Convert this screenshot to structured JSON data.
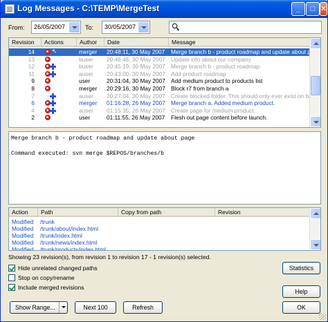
{
  "window": {
    "title": "Log Messages - C:\\TEMP\\MergeTest"
  },
  "title_buttons": {
    "minimize": "_",
    "maximize": "□",
    "close": "✕"
  },
  "filter": {
    "from_label": "From:",
    "from_value": "26/05/2007",
    "to_label": "To:",
    "to_value": "30/05/2007",
    "search_value": ""
  },
  "revision_list": {
    "columns": [
      "Revision",
      "Actions",
      "Author",
      "Date",
      "Message"
    ],
    "rows": [
      {
        "revision": "14",
        "actions": [
          "r",
          "arrow"
        ],
        "author": "merger",
        "date": "20:48:11, 30 May 2007",
        "message": "Merge branch b - product roadmap and update about page",
        "style": "sel"
      },
      {
        "revision": "13",
        "actions": [
          "r"
        ],
        "author": "buser",
        "date": "20:46:48, 30 May 2007",
        "message": "Update info about our company",
        "style": "gray"
      },
      {
        "revision": "12",
        "actions": [
          "r",
          "p"
        ],
        "author": "buser",
        "date": "20:45:19, 30 May 2007",
        "message": "Merge branch b - product roadmap",
        "style": "gray"
      },
      {
        "revision": "11",
        "actions": [
          "r",
          "p"
        ],
        "author": "auser",
        "date": "20:43:00, 30 May 2007",
        "message": "Add product roadmap",
        "style": "gray"
      },
      {
        "revision": "9",
        "actions": [
          "r"
        ],
        "author": "user",
        "date": "20:31:04, 30 May 2007",
        "message": "Add medium product to products list",
        "style": "normal"
      },
      {
        "revision": "8",
        "actions": [
          "r"
        ],
        "author": "merger",
        "date": "20:29:16, 30 May 2007",
        "message": "Block r7 from branch a",
        "style": "normal"
      },
      {
        "revision": "7",
        "actions": [
          "p"
        ],
        "author": "auser",
        "date": "20:27:04, 30 May 2007",
        "message": "Create blocked folder. This should only ever exist on bra",
        "style": "gray"
      },
      {
        "revision": "6",
        "actions": [
          "r",
          "p"
        ],
        "author": "merger",
        "date": "01:16:28, 26 May 2007",
        "message": "Merge branch a. Added medium product.",
        "style": "blue"
      },
      {
        "revision": "4",
        "actions": [
          "r",
          "p"
        ],
        "author": "auser",
        "date": "01:15:35, 26 May 2007",
        "message": "Create page for medium product.",
        "style": "gray"
      },
      {
        "revision": "2",
        "actions": [
          "r"
        ],
        "author": "user",
        "date": "01:11:55, 26 May 2007",
        "message": "Flesh out page content before launch.",
        "style": "normal"
      }
    ]
  },
  "message": {
    "lines": [
      "Merge branch b - product roadmap and update about page",
      "",
      "Command executed: svn merge $REPOS/branches/b"
    ]
  },
  "paths": {
    "columns": [
      "Action",
      "Path",
      "Copy from path",
      "Revision"
    ],
    "rows": [
      {
        "action": "Modified",
        "path": "/trunk"
      },
      {
        "action": "Modified",
        "path": "/trunk/about/index.html"
      },
      {
        "action": "Modified",
        "path": "/trunk/index.html"
      },
      {
        "action": "Modified",
        "path": "/trunk/news/index.html"
      },
      {
        "action": "Modified",
        "path": "/trunk/products/index.html"
      }
    ]
  },
  "status_text": "Showing 23 revision(s), from revision 1 to revision 17 - 1 revision(s) selected.",
  "options": [
    {
      "label": "Hide unrelated changed paths",
      "checked": true
    },
    {
      "label": "Stop on copy/rename",
      "checked": false
    },
    {
      "label": "Include merged revisions",
      "checked": true
    }
  ],
  "buttons": {
    "statistics": "Statistics",
    "help": "Help",
    "show_range": "Show Range...",
    "next": "Next 100",
    "refresh": "Refresh",
    "ok": "OK"
  }
}
